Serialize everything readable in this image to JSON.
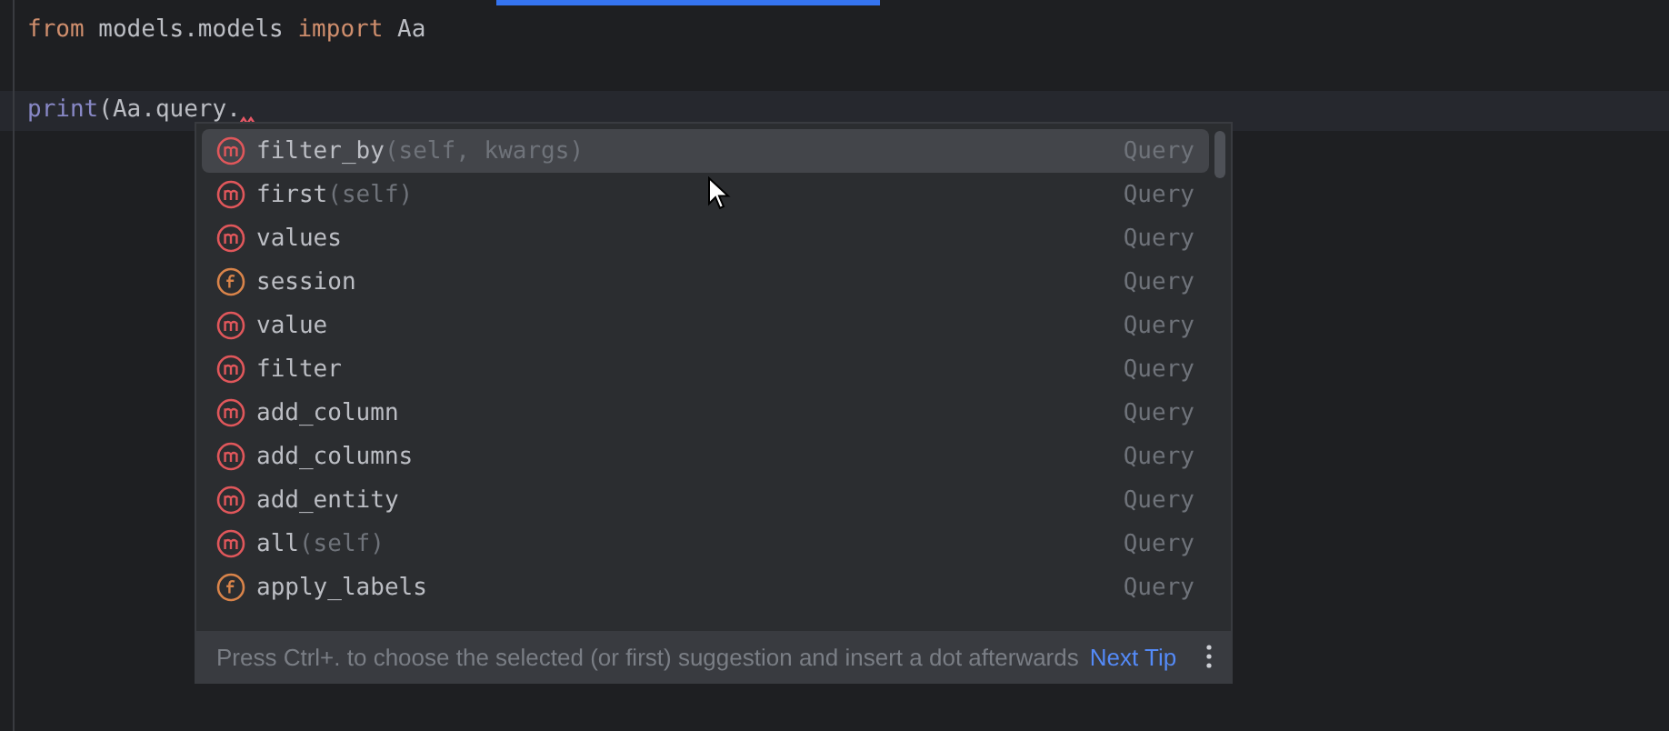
{
  "editor": {
    "lines": [
      {
        "tokens": [
          {
            "kind": "keyword",
            "text": "from"
          },
          {
            "kind": "plain",
            "text": " models.models "
          },
          {
            "kind": "keyword",
            "text": "import"
          },
          {
            "kind": "plain",
            "text": " Aa"
          }
        ]
      },
      {
        "blank": true
      },
      {
        "current": true,
        "error_mark": true,
        "tokens": [
          {
            "kind": "builtin",
            "text": "print"
          },
          {
            "kind": "plain",
            "text": "(Aa.query."
          }
        ]
      }
    ]
  },
  "completion": {
    "items": [
      {
        "kind": "method",
        "name": "filter_by",
        "params": "(self, kwargs)",
        "type": "Query",
        "selected": true
      },
      {
        "kind": "method",
        "name": "first",
        "params": "(self)",
        "type": "Query",
        "selected": false
      },
      {
        "kind": "method",
        "name": "values",
        "type": "Query",
        "selected": false
      },
      {
        "kind": "field",
        "name": "session",
        "type": "Query",
        "selected": false
      },
      {
        "kind": "method",
        "name": "value",
        "type": "Query",
        "selected": false
      },
      {
        "kind": "method",
        "name": "filter",
        "type": "Query",
        "selected": false
      },
      {
        "kind": "method",
        "name": "add_column",
        "type": "Query",
        "selected": false
      },
      {
        "kind": "method",
        "name": "add_columns",
        "type": "Query",
        "selected": false
      },
      {
        "kind": "method",
        "name": "add_entity",
        "type": "Query",
        "selected": false
      },
      {
        "kind": "method",
        "name": "all",
        "params": "(self)",
        "type": "Query",
        "selected": false
      },
      {
        "kind": "field",
        "name": "apply_labels",
        "type": "Query",
        "selected": false
      }
    ],
    "footer": {
      "hint": "Press Ctrl+. to choose the selected (or first) suggestion and insert a dot afterwards",
      "link": "Next Tip"
    }
  }
}
